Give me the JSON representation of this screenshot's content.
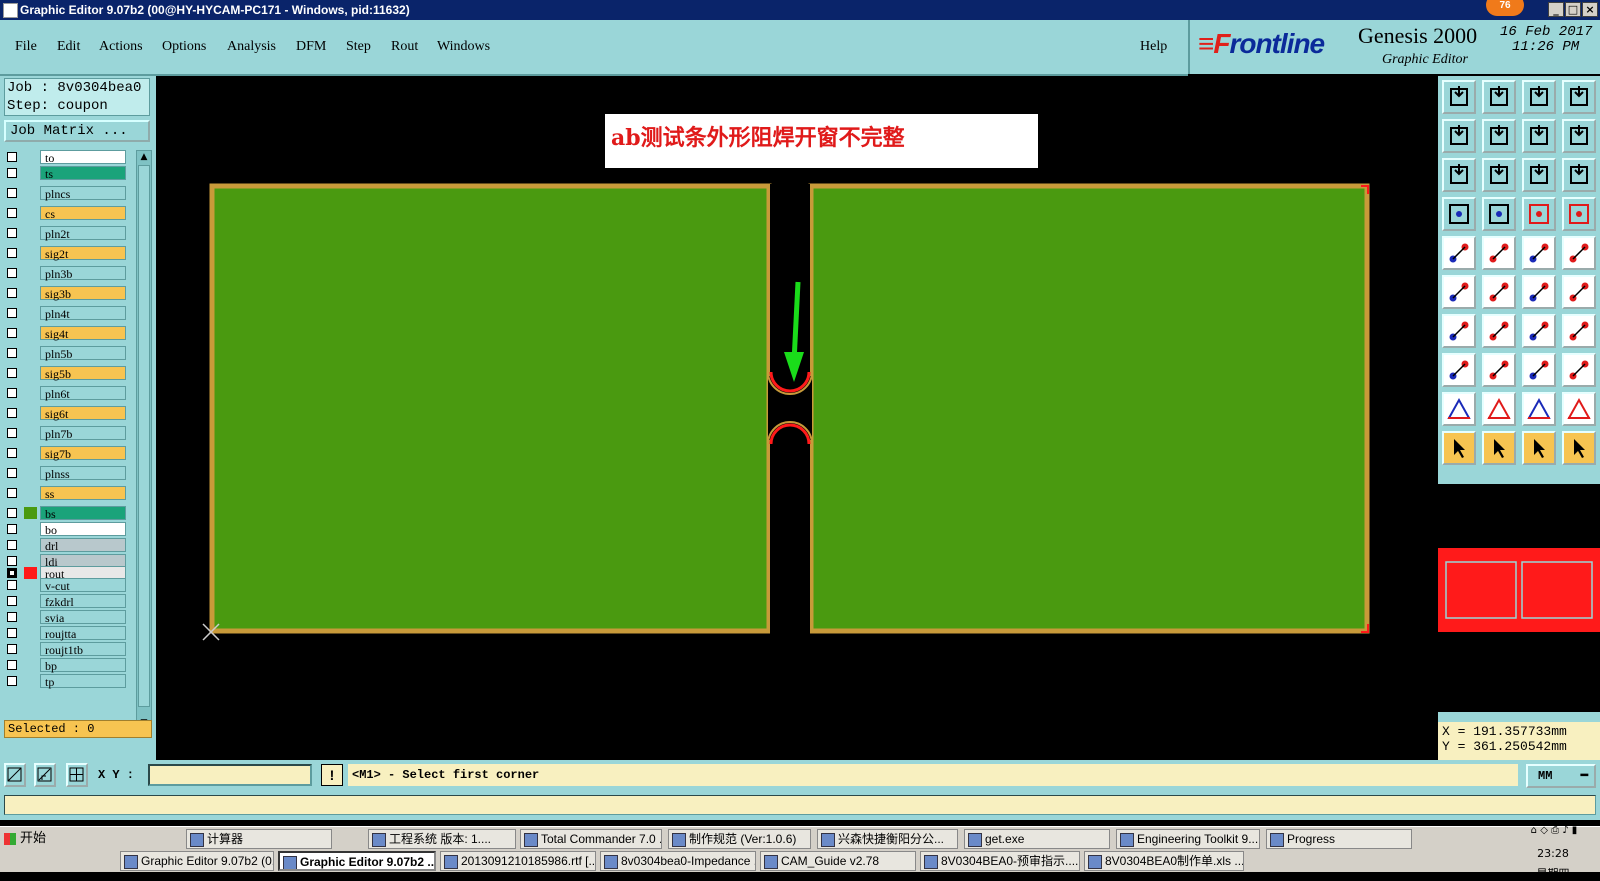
{
  "window": {
    "title": "Graphic Editor 9.07b2 (00@HY-HYCAM-PC171 - Windows, pid:11632)",
    "badge": "76"
  },
  "menu": {
    "items": [
      "File",
      "Edit",
      "Actions",
      "Options",
      "Analysis",
      "DFM",
      "Step",
      "Rout",
      "Windows"
    ],
    "help": "Help"
  },
  "brand": {
    "logo_pre": "F",
    "logo_rest": "rontline",
    "product": "Genesis 2000",
    "subtitle": "Graphic Editor",
    "date": "16 Feb 2017",
    "time": "11:26 PM"
  },
  "job": {
    "job_line": "Job : 8v0304bea0",
    "step_line": "Step: coupon",
    "matrix_button": "Job Matrix ..."
  },
  "layers": [
    {
      "name": "to",
      "color": "#ffffff",
      "checked": false
    },
    {
      "name": "ts",
      "color": "#1aa37a",
      "checked": false
    },
    {
      "name": "plncs",
      "color": "#9ad6d8",
      "checked": false
    },
    {
      "name": "cs",
      "color": "#f7c451",
      "checked": false
    },
    {
      "name": "pln2t",
      "color": "#9ad6d8",
      "checked": false
    },
    {
      "name": "sig2t",
      "color": "#f7c451",
      "checked": false
    },
    {
      "name": "pln3b",
      "color": "#9ad6d8",
      "checked": false
    },
    {
      "name": "sig3b",
      "color": "#f7c451",
      "checked": false
    },
    {
      "name": "pln4t",
      "color": "#9ad6d8",
      "checked": false
    },
    {
      "name": "sig4t",
      "color": "#f7c451",
      "checked": false
    },
    {
      "name": "pln5b",
      "color": "#9ad6d8",
      "checked": false
    },
    {
      "name": "sig5b",
      "color": "#f7c451",
      "checked": false
    },
    {
      "name": "pln6t",
      "color": "#9ad6d8",
      "checked": false
    },
    {
      "name": "sig6t",
      "color": "#f7c451",
      "checked": false
    },
    {
      "name": "pln7b",
      "color": "#9ad6d8",
      "checked": false
    },
    {
      "name": "sig7b",
      "color": "#f7c451",
      "checked": false
    },
    {
      "name": "plnss",
      "color": "#9ad6d8",
      "checked": false
    },
    {
      "name": "ss",
      "color": "#f7c451",
      "checked": false
    },
    {
      "name": "bs",
      "color": "#1aa37a",
      "checked": false,
      "swatch": "#4a9a10"
    },
    {
      "name": "bo",
      "color": "#ffffff",
      "checked": false
    },
    {
      "name": "drl",
      "color": "#b8c8cc",
      "checked": false
    },
    {
      "name": "ldi",
      "color": "#b8c8cc",
      "checked": false
    },
    {
      "name": "rout",
      "color": "#e8e8e8",
      "checked": true,
      "swatch": "#ff1a1a"
    },
    {
      "name": "v-cut",
      "color": "#9ad6d8",
      "checked": false
    },
    {
      "name": "fzkdrl",
      "color": "#9ad6d8",
      "checked": false
    },
    {
      "name": "svia",
      "color": "#9ad6d8",
      "checked": false
    },
    {
      "name": "roujtta",
      "color": "#9ad6d8",
      "checked": false
    },
    {
      "name": "roujt1tb",
      "color": "#9ad6d8",
      "checked": false
    },
    {
      "name": "bp",
      "color": "#9ad6d8",
      "checked": false
    },
    {
      "name": "tp",
      "color": "#9ad6d8",
      "checked": false
    }
  ],
  "selected": "Selected : 0",
  "annotation": "ab测试条外形阻焊开窗不完整",
  "coords": {
    "x": "X = 191.357733mm",
    "y": "Y = 361.250542mm"
  },
  "input": {
    "label": "X Y :",
    "value": "",
    "prompt": "<M1> - Select first corner",
    "unit": "MM",
    "warn": "!"
  },
  "colors": {
    "board": "#4a9a10",
    "outline": "#c89a3a",
    "rout": "#ff1a1a",
    "arrow": "#1adc1a",
    "panel": "#9ad6d8"
  },
  "taskbar": {
    "start": "开始",
    "row1": [
      "计算器",
      "工程系统  版本: 1....",
      "Total Commander 7.0 ...",
      "制作规范 (Ver:1.0.6)",
      "兴森快捷衡阳分公...",
      "get.exe",
      "Engineering Toolkit 9....",
      "Progress"
    ],
    "row2": [
      "Graphic Editor 9.07b2 (0...",
      "Graphic Editor 9.07b2 ...",
      "2013091210185986.rtf [...",
      "8v0304bea0-Impedance ...",
      "CAM_Guide v2.78",
      "8V0304BEA0-预审指示....",
      "8V0304BEA0制作单.xls ..."
    ],
    "clock_time": "23:28",
    "clock_day": "星期四"
  }
}
